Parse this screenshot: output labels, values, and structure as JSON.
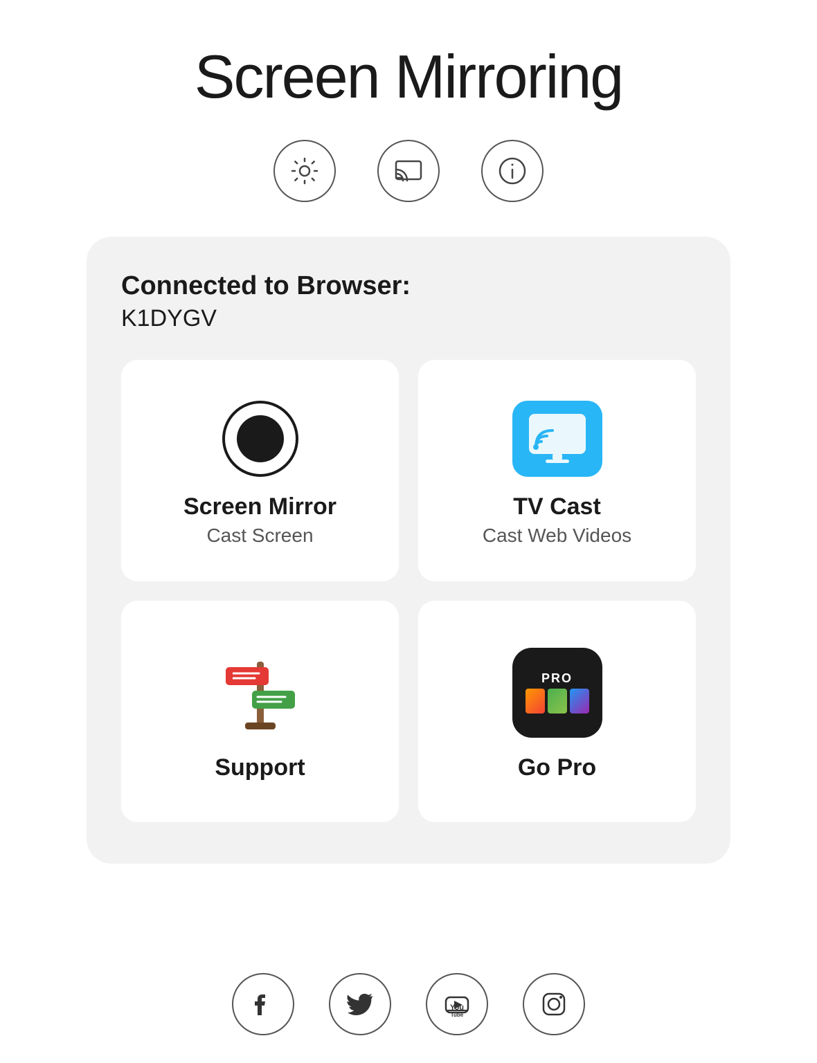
{
  "header": {
    "title": "Screen Mirroring"
  },
  "top_icons": [
    {
      "name": "settings-icon",
      "label": "Settings"
    },
    {
      "name": "cast-icon",
      "label": "Cast"
    },
    {
      "name": "info-icon",
      "label": "Info"
    }
  ],
  "connected": {
    "label": "Connected to Browser:",
    "id": "K1DYGV"
  },
  "grid": [
    {
      "name": "screen-mirror",
      "title": "Screen Mirror",
      "subtitle": "Cast Screen",
      "icon_type": "record"
    },
    {
      "name": "tv-cast",
      "title": "TV Cast",
      "subtitle": "Cast Web Videos",
      "icon_type": "tv"
    },
    {
      "name": "support",
      "title": "Support",
      "subtitle": "",
      "icon_type": "signpost"
    },
    {
      "name": "go-pro",
      "title": "Go Pro",
      "subtitle": "",
      "icon_type": "gopro"
    }
  ],
  "social": [
    {
      "name": "facebook-icon",
      "label": "Facebook"
    },
    {
      "name": "twitter-icon",
      "label": "Twitter"
    },
    {
      "name": "youtube-icon",
      "label": "YouTube"
    },
    {
      "name": "instagram-icon",
      "label": "Instagram"
    }
  ]
}
